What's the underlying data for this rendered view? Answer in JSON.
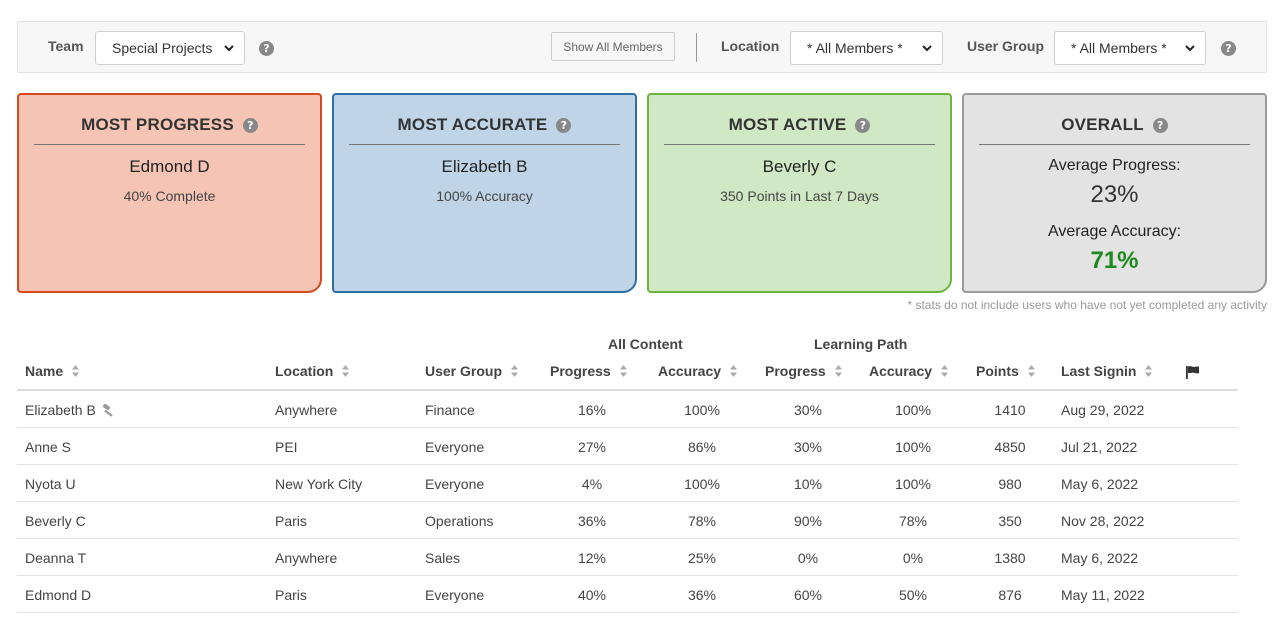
{
  "filters": {
    "team_label": "Team",
    "team_value": "Special Projects",
    "show_all_label": "Show All Members",
    "location_label": "Location",
    "location_value": "* All Members *",
    "user_group_label": "User Group",
    "user_group_value": "* All Members *"
  },
  "cards": {
    "progress": {
      "title": "MOST PROGRESS",
      "name": "Edmond D",
      "sub": "40% Complete"
    },
    "accurate": {
      "title": "MOST ACCURATE",
      "name": "Elizabeth B",
      "sub": "100% Accuracy"
    },
    "active": {
      "title": "MOST ACTIVE",
      "name": "Beverly C",
      "sub": "350 Points in Last 7 Days"
    },
    "overall": {
      "title": "OVERALL",
      "avg_progress_label": "Average Progress:",
      "avg_progress_value": "23%",
      "avg_accuracy_label": "Average Accuracy:",
      "avg_accuracy_value": "71%"
    }
  },
  "footnote": "* stats do not include users who have not yet completed any activity",
  "table": {
    "group_headers": {
      "all_content": "All Content",
      "learning_path": "Learning Path"
    },
    "columns": {
      "name": "Name",
      "location": "Location",
      "user_group": "User Group",
      "ac_progress": "Progress",
      "ac_accuracy": "Accuracy",
      "lp_progress": "Progress",
      "lp_accuracy": "Accuracy",
      "points": "Points",
      "last_signin": "Last Signin"
    },
    "rows": [
      {
        "name": "Elizabeth B",
        "location": "Anywhere",
        "user_group": "Finance",
        "ac_progress": "16%",
        "ac_accuracy": "100%",
        "lp_progress": "30%",
        "lp_accuracy": "100%",
        "points": "1410",
        "last_signin": "Aug 29, 2022"
      },
      {
        "name": "Anne S",
        "location": "PEI",
        "user_group": "Everyone",
        "ac_progress": "27%",
        "ac_accuracy": "86%",
        "lp_progress": "30%",
        "lp_accuracy": "100%",
        "points": "4850",
        "last_signin": "Jul 21, 2022"
      },
      {
        "name": "Nyota U",
        "location": "New York City",
        "user_group": "Everyone",
        "ac_progress": "4%",
        "ac_accuracy": "100%",
        "lp_progress": "10%",
        "lp_accuracy": "100%",
        "points": "980",
        "last_signin": "May 6, 2022"
      },
      {
        "name": "Beverly C",
        "location": "Paris",
        "user_group": "Operations",
        "ac_progress": "36%",
        "ac_accuracy": "78%",
        "lp_progress": "90%",
        "lp_accuracy": "78%",
        "points": "350",
        "last_signin": "Nov 28, 2022"
      },
      {
        "name": "Deanna T",
        "location": "Anywhere",
        "user_group": "Sales",
        "ac_progress": "12%",
        "ac_accuracy": "25%",
        "lp_progress": "0%",
        "lp_accuracy": "0%",
        "points": "1380",
        "last_signin": "May 6, 2022"
      },
      {
        "name": "Edmond D",
        "location": "Paris",
        "user_group": "Everyone",
        "ac_progress": "40%",
        "ac_accuracy": "36%",
        "lp_progress": "60%",
        "lp_accuracy": "50%",
        "points": "876",
        "last_signin": "May 11, 2022"
      }
    ]
  },
  "colors": {
    "progress_bg": "#f5c4b4",
    "progress_border": "#d4491f",
    "accurate_bg": "#bfd4e6",
    "accurate_border": "#2f6fa8",
    "active_bg": "#d1e8c4",
    "active_border": "#6cb33f",
    "overall_bg": "#e3e3e3",
    "overall_border": "#9a9a9a",
    "accuracy_green": "#1c8a1c"
  },
  "icons": {
    "help": "question-circle-icon",
    "sort": "sort-icon",
    "flag": "flag-icon",
    "gavel": "gavel-icon",
    "chevron": "chevron-down-icon"
  }
}
